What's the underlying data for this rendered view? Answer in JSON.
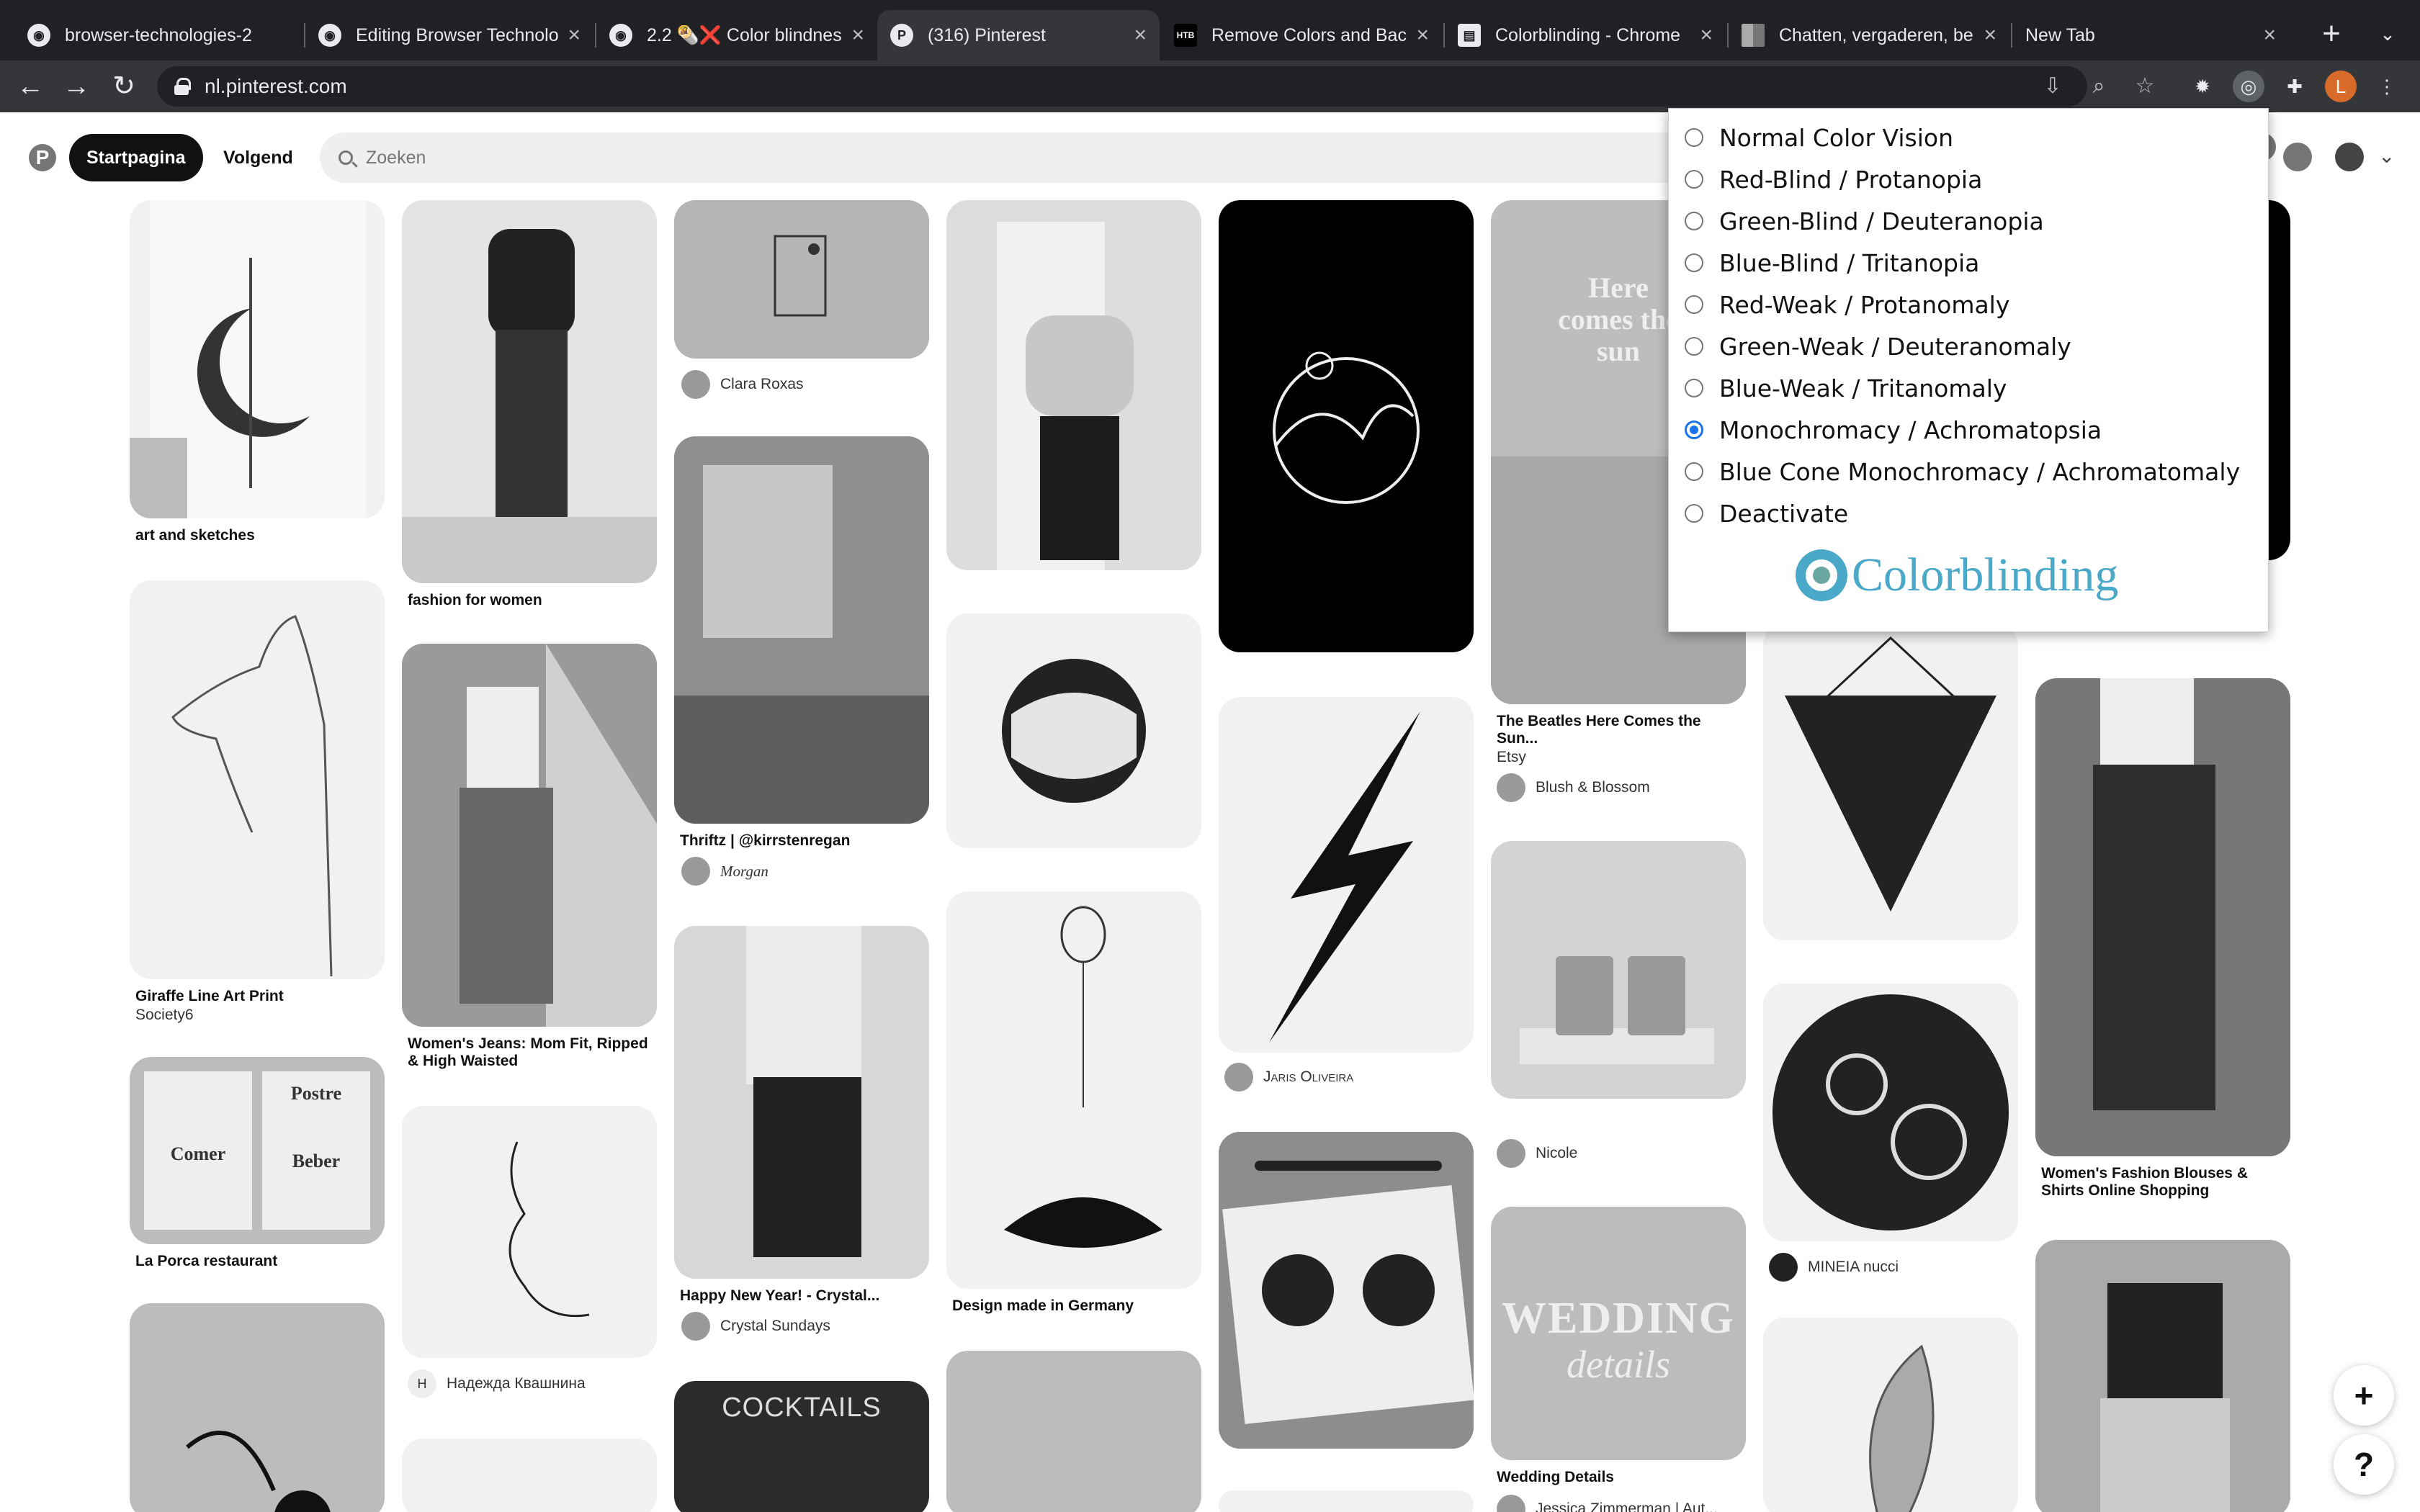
{
  "browser": {
    "tabs": [
      {
        "title": "browser-technologies-2",
        "icon": "github-icon"
      },
      {
        "title": "Editing Browser Technolo",
        "icon": "github-icon"
      },
      {
        "title": "2.2 🌯❌ Color blindnes",
        "icon": "github-icon"
      },
      {
        "title": "(316) Pinterest",
        "icon": "pinterest-icon",
        "active": true
      },
      {
        "title": "Remove Colors and Bac",
        "icon": "htb-icon"
      },
      {
        "title": "Colorblinding - Chrome",
        "icon": "chrome-webstore-icon"
      },
      {
        "title": "Chatten, vergaderen, be",
        "icon": "microsoft-icon"
      },
      {
        "title": "New Tab",
        "icon": ""
      }
    ],
    "url": "nl.pinterest.com",
    "profile_initial": "L",
    "favicon_letters": {
      "htb": "HTB"
    }
  },
  "pinterest": {
    "nav": {
      "home": "Startpagina",
      "following": "Volgend"
    },
    "search_placeholder": "Zoeken",
    "pins": {
      "art": "art and sketches",
      "fashion": "fashion for women",
      "clara": "Clara Roxas",
      "giraffe": "Giraffe Line Art Print",
      "society6": "Society6",
      "jeans": "Women's Jeans: Mom Fit, Ripped & High Waisted",
      "thriftz": "Thriftz | @kirrstenregan",
      "morgan": "Morgan",
      "laporca": "La Porca restaurant",
      "nadezhda": "Надежда Квашнина",
      "nadezhda_initial": "H",
      "happynewyear": "Happy New Year! - Crystal...",
      "crystal": "Crystal Sundays",
      "cocktails": "COCKTAILS",
      "germany": "Design made in Germany",
      "jaris": "Jaris Oliveira",
      "beatles": "The Beatles Here Comes the Sun...",
      "etsy": "Etsy",
      "blush": "Blush & Blossom",
      "nicole": "Nicole",
      "wedding": "Wedding Details",
      "wedding_overlay": "WEDDING",
      "wedding_script": "details",
      "jessica": "Jessica Zimmerman | Aut...",
      "mineia": "MINEIA nucci",
      "blouses": "Women's Fashion Blouses & Shirts Online Shopping",
      "herecomes": "Here comes the sun",
      "poster_left": "Comer",
      "poster_right": "Beber",
      "poster_title": "Postre"
    }
  },
  "colorblinding": {
    "options": [
      "Normal Color Vision",
      "Red-Blind / Protanopia",
      "Green-Blind / Deuteranopia",
      "Blue-Blind / Tritanopia",
      "Red-Weak / Protanomaly",
      "Green-Weak / Deuteranomaly",
      "Blue-Weak / Tritanomaly",
      "Monochromacy / Achromatopsia",
      "Blue Cone Monochromacy / Achromatomaly",
      "Deactivate"
    ],
    "selected": "Monochromacy / Achromatopsia",
    "brand": "Colorblinding"
  },
  "fab": {
    "add": "+",
    "help": "?"
  }
}
